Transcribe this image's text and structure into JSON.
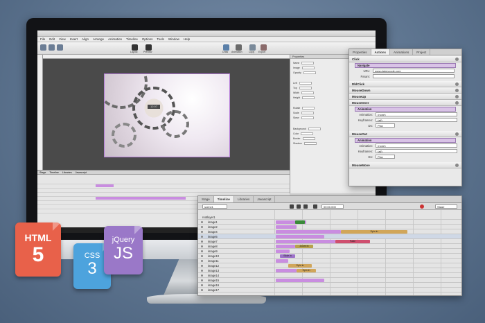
{
  "colors": {
    "accent_purple": "#d9c3e6",
    "html5": "#e8614a",
    "css3": "#4da3dd",
    "jquery": "#9a78c8"
  },
  "app": {
    "menu": [
      "File",
      "Edit",
      "View",
      "Insert",
      "Align",
      "Arrange",
      "Animation",
      "Timeline",
      "Options",
      "Tools",
      "Window",
      "Help"
    ],
    "toolbar_labels": [
      "Layout",
      "Preview",
      "Draw",
      "Animation",
      "Copy",
      "Export"
    ],
    "canvas_clock_text": "12:07",
    "props_header": "Properties",
    "props_rows": [
      "Name",
      "Image",
      "Opacity",
      "Left",
      "Top",
      "Width",
      "Height",
      "Rotate",
      "Scale",
      "Skew",
      "Background",
      "Color",
      "Border",
      "Shadow"
    ],
    "tl_tabs": [
      "Stage",
      "Timeline",
      "Libraries",
      "Javascript"
    ]
  },
  "actions_panel": {
    "tabs": [
      "Properties",
      "Actions",
      "Animations",
      "Project"
    ],
    "sections": {
      "click": "Click",
      "navigate": "Navigate",
      "url_label": "URL:",
      "url_value": "www.daimvcode.com",
      "param_label": "Param:",
      "param_value": "",
      "dblclick": "DblClick",
      "mousedown": "MouseDown",
      "mouseup": "MouseUp",
      "mouseover": "MouseOver",
      "animation": "Animation",
      "animation_label": "Animation:",
      "animation_value": "(none)",
      "keyframes_label": "Keyframes:",
      "keyframes_value": "(all)",
      "do_label": "Do:",
      "do_value": "Play",
      "mouseout": "MouseOut",
      "animation2": "Animation",
      "animation2_value": "(none)",
      "keyframes2_value": "(all)",
      "do2_value": "Play",
      "mousemove": "MouseMove"
    }
  },
  "timeline_panel": {
    "tabs": [
      "Stage",
      "Timeline",
      "Libraries",
      "Javascript"
    ],
    "scene_select": "scene1",
    "time_display": "00:00.000",
    "stage_select": "Stage",
    "root_layer": "rootlayer1",
    "layers": [
      "image1",
      "image2",
      "image4",
      "image5",
      "image7",
      "image8",
      "image9",
      "image10",
      "image11",
      "image12",
      "image13",
      "image14",
      "image15",
      "image16",
      "image17"
    ],
    "bar_labels": {
      "b1": "Spin in",
      "b2": "Spin in",
      "b3": "Fade",
      "b4": "Zoom in",
      "b5": "Slide in",
      "b6": "Spin in"
    }
  },
  "badges": {
    "html": "HTML",
    "html_num": "5",
    "css": "CSS",
    "css_num": "3",
    "jquery": "jQuery",
    "js": "JS"
  }
}
